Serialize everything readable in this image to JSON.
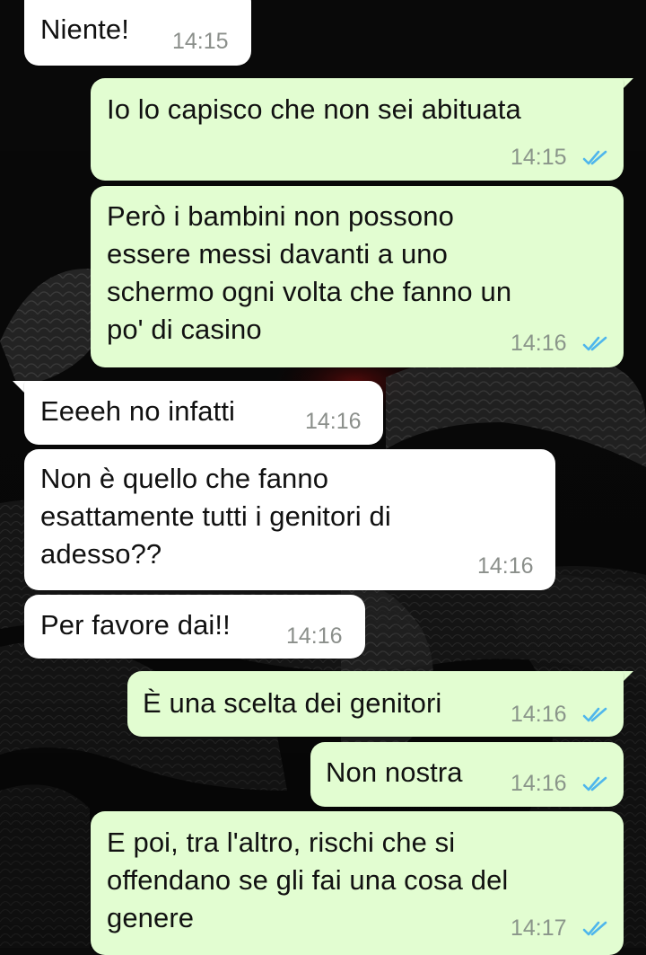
{
  "colors": {
    "incoming_bubble": "#ffffff",
    "outgoing_bubble": "#e2fdd1",
    "read_ticks": "#4fb6ec",
    "time_text": "#8b8f8b",
    "wallpaper": "#0b0b0b"
  },
  "icons": {
    "read_receipt": "double-check-icon",
    "bubble_tail": "bubble-tail"
  },
  "messages": [
    {
      "direction": "in",
      "text": "Niente!",
      "time": "14:15"
    },
    {
      "direction": "out",
      "text": "Io lo capisco che non sei abituata",
      "time": "14:15",
      "status": "read"
    },
    {
      "direction": "out",
      "text": "Però i bambini non possono\nessere messi davanti a uno\nschermo ogni volta che fanno un\npo' di casino",
      "time": "14:16",
      "status": "read"
    },
    {
      "direction": "in",
      "text": "Eeeeh no infatti",
      "time": "14:16"
    },
    {
      "direction": "in",
      "text": "Non è quello che fanno\nesattamente tutti i genitori di\nadesso??",
      "time": "14:16"
    },
    {
      "direction": "in",
      "text": "Per favore dai!!",
      "time": "14:16"
    },
    {
      "direction": "out",
      "text": "È una scelta dei genitori",
      "time": "14:16",
      "status": "read"
    },
    {
      "direction": "out",
      "text": "Non nostra",
      "time": "14:16",
      "status": "read"
    },
    {
      "direction": "out",
      "text": "E poi, tra l'altro, rischi che si\noffendano se gli fai una cosa del\ngenere",
      "time": "14:17",
      "status": "read"
    }
  ]
}
